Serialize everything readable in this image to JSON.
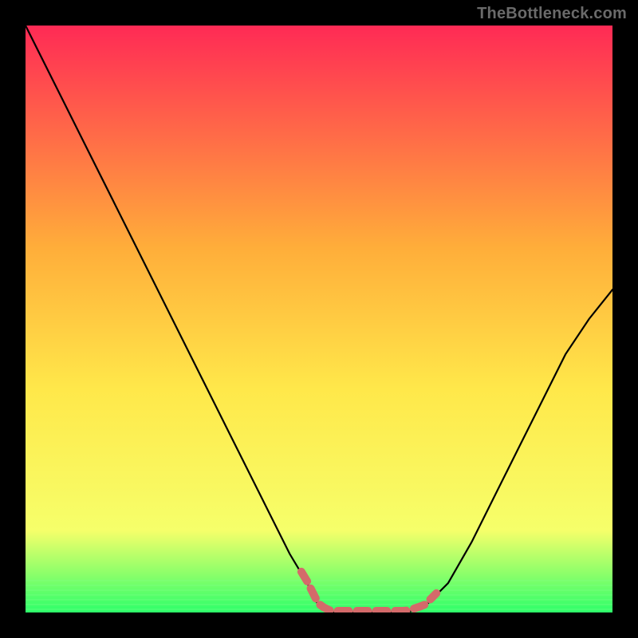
{
  "watermark": "TheBottleneck.com",
  "colors": {
    "bg_black": "#000000",
    "grad_top": "#ff2a55",
    "grad_mid1": "#ffae3a",
    "grad_mid2": "#ffe84a",
    "grad_mid3": "#f6ff6a",
    "grad_bottom": "#2dff6a",
    "curve": "#000000",
    "marker": "#d46a6a"
  },
  "chart_data": {
    "type": "line",
    "title": "",
    "xlabel": "",
    "ylabel": "",
    "xlim": [
      0,
      100
    ],
    "ylim": [
      0,
      100
    ],
    "x": [
      0,
      5,
      10,
      15,
      20,
      25,
      30,
      35,
      40,
      45,
      48,
      50,
      52,
      55,
      58,
      60,
      62,
      65,
      68,
      72,
      76,
      80,
      84,
      88,
      92,
      96,
      100
    ],
    "y": [
      100,
      90,
      80,
      70,
      60,
      50,
      40,
      30,
      20,
      10,
      5,
      1,
      0,
      0,
      0,
      0,
      0,
      0,
      1,
      5,
      12,
      20,
      28,
      36,
      44,
      50,
      55
    ],
    "flat_region_x": [
      52,
      68
    ],
    "note": "Approximate bottleneck curve: steep decline from top-left to a flat minimum near 55–65% on x, then a gentler rise to about 55% height at the right edge. Values are estimated from pixel positions; the original image has no axis ticks or numeric labels."
  }
}
